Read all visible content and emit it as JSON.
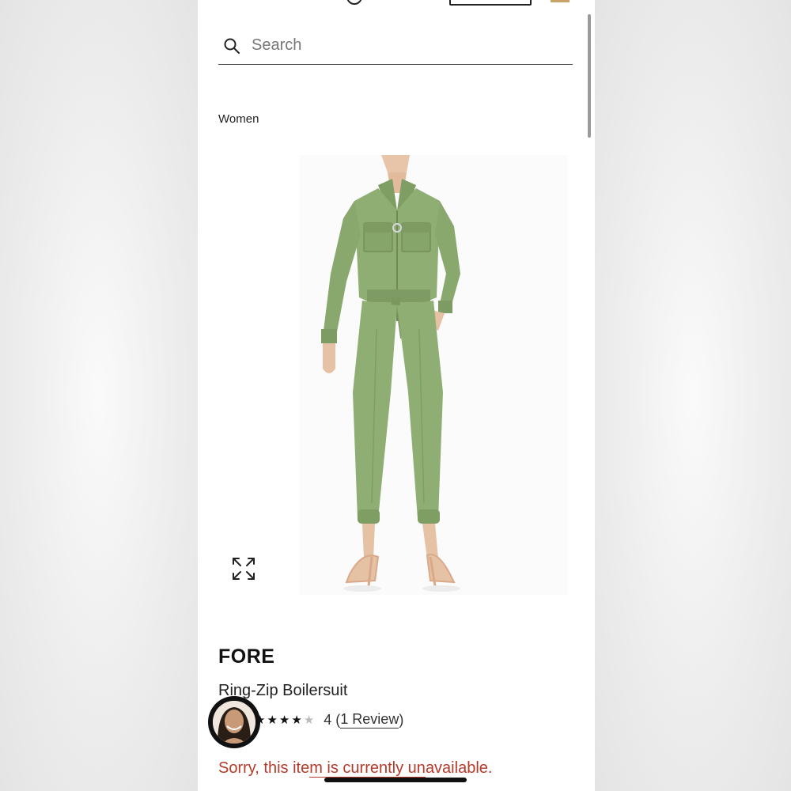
{
  "search": {
    "placeholder": "Search"
  },
  "breadcrumb": {
    "label": "Women"
  },
  "product": {
    "brand": "FORE",
    "name": "Ring-Zip Boilersuit",
    "rating": {
      "value": "4",
      "review_open": "(",
      "review_link": "1 Review",
      "review_close": ")",
      "filled_stars": 4,
      "total_stars": 5
    },
    "availability_prefix": "Sorry, this ite",
    "availability_underlined": "m is currently un",
    "availability_suffix": "available."
  },
  "colors": {
    "garment": "#8fae74",
    "error": "#b53a2a",
    "accent": "#c9a46a"
  },
  "icons": {
    "search": "search-icon",
    "expand": "expand-icon"
  }
}
